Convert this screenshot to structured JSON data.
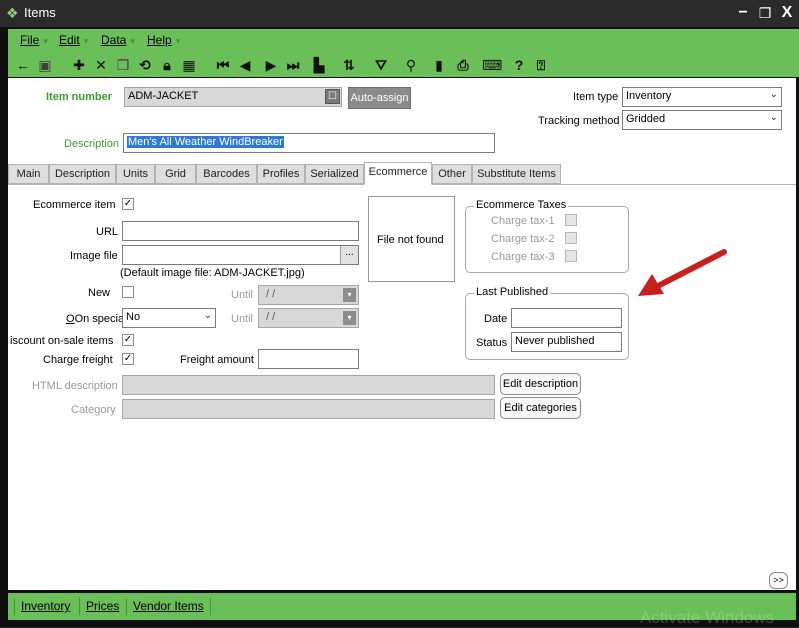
{
  "window": {
    "title": "Items",
    "minimize": "−",
    "restore": "❐",
    "close": "X"
  },
  "menu": [
    {
      "label": "File",
      "accel": "F"
    },
    {
      "label": "Edit",
      "accel": "E"
    },
    {
      "label": "Data",
      "accel": "D"
    },
    {
      "label": "Help",
      "accel": "H"
    }
  ],
  "toolbar_icons": [
    "back-arrow",
    "save",
    "add",
    "delete",
    "copy",
    "refresh",
    "lock",
    "grid",
    "first",
    "prev",
    "next",
    "last",
    "layout",
    "sort",
    "filter",
    "search",
    "document",
    "print",
    "keyboard",
    "help",
    "context-help"
  ],
  "form": {
    "item_number_label": "Item number",
    "item_number_value": "ADM-JACKET",
    "auto_assign_label": "Auto-assign",
    "description_label": "Description",
    "description_value": "Men's All Weather WindBreaker",
    "item_type_label": "Item type",
    "item_type_value": "Inventory",
    "tracking_method_label": "Tracking method",
    "tracking_method_value": "Gridded"
  },
  "tabs": [
    "Main",
    "Description",
    "Units",
    "Grid",
    "Barcodes",
    "Profiles",
    "Serialized",
    "Ecommerce",
    "Other",
    "Substitute Items"
  ],
  "active_tab": "Ecommerce",
  "ecommerce": {
    "ecommerce_item_label": "Ecommerce item",
    "url_label": "URL",
    "url_value": "",
    "image_file_label": "Image file",
    "image_file_value": "",
    "image_browse": "...",
    "default_image_note": "(Default image file: ADM-JACKET.jpg)",
    "image_preview_text": "File not found",
    "new_label": "New",
    "until_label": "Until",
    "until_value": "/ /",
    "on_special_label": "On special",
    "on_special_value": "No",
    "discount_label": "iscount on-sale items",
    "charge_freight_label": "Charge freight",
    "freight_amount_label": "Freight amount",
    "freight_amount_value": "",
    "html_description_label": "HTML description",
    "edit_description_button": "Edit description",
    "category_label": "Category",
    "edit_categories_button": "Edit categories"
  },
  "taxes": {
    "title": "Ecommerce Taxes",
    "items": [
      "Charge tax-1",
      "Charge tax-2",
      "Charge tax-3"
    ]
  },
  "last_published": {
    "title": "Last Published",
    "date_label": "Date",
    "date_value": "",
    "status_label": "Status",
    "status_value": "Never published"
  },
  "more_button": ">>",
  "footer": [
    "Inventory",
    "Prices",
    "Vendor Items"
  ],
  "watermark": "Activate Windows",
  "colors": {
    "accent_green": "#6abf59",
    "label_green": "#3c9a2c",
    "arrow_red": "#c8201f"
  }
}
